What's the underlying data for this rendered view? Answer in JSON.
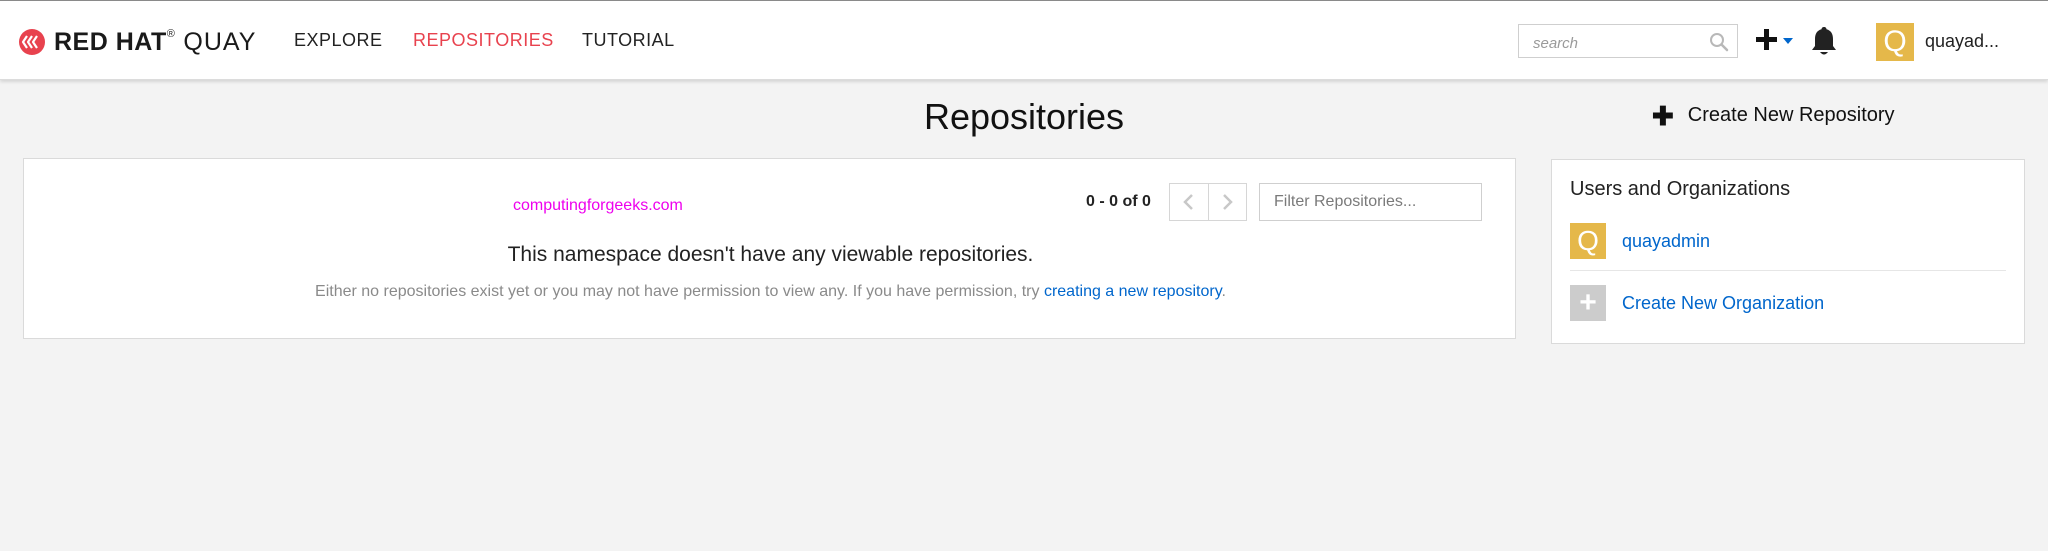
{
  "header": {
    "brand_primary": "RED HAT",
    "brand_secondary": "QUAY",
    "nav": [
      {
        "label": "EXPLORE"
      },
      {
        "label": "REPOSITORIES",
        "active": true
      },
      {
        "label": "TUTORIAL"
      }
    ],
    "search": {
      "placeholder": "search",
      "value": ""
    },
    "user": {
      "avatar_letter": "Q",
      "name": "quayad..."
    },
    "icons": [
      "redhat-logo-icon",
      "search-icon",
      "plus-icon",
      "caret-down-icon",
      "bell-icon"
    ]
  },
  "page": {
    "title": "Repositories",
    "create_repo_label": "Create New Repository"
  },
  "main": {
    "namespace": "computingforgeeks.com",
    "pager_count": "0 - 0 of 0",
    "filter": {
      "placeholder": "Filter Repositories...",
      "value": ""
    },
    "empty_title": "This namespace doesn't have any viewable repositories.",
    "empty_desc_prefix": "Either no repositories exist yet or you may not have permission to view any. If you have permission, try ",
    "empty_desc_link": "creating a new repository",
    "empty_desc_suffix": "."
  },
  "sidebar": {
    "title": "Users and Organizations",
    "items": [
      {
        "avatar_letter": "Q",
        "label": "quayadmin"
      },
      {
        "avatar_letter": "+",
        "label": "Create New Organization"
      }
    ]
  },
  "colors": {
    "accent_red": "#e8424e",
    "link_blue": "#0066cc",
    "namespace_magenta": "#ee00ee",
    "avatar_gold": "#e5b84a"
  }
}
